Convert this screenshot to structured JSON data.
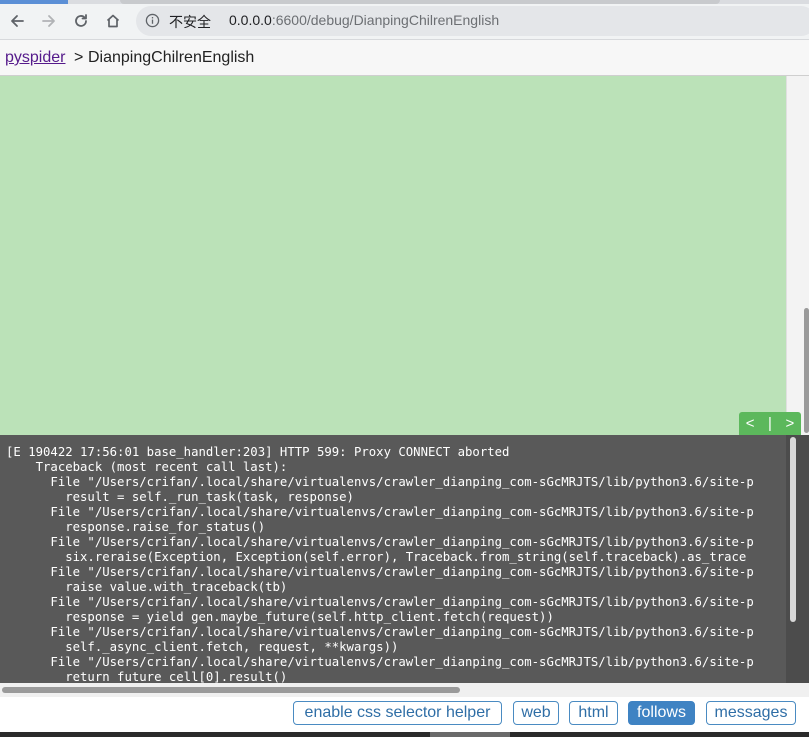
{
  "browser": {
    "security_label": "不安全",
    "url_host": "0.0.0.0",
    "url_rest": ":6600/debug/DianpingChilrenEnglish"
  },
  "breadcrumb": {
    "root": "pyspider",
    "separator": ">",
    "project": "DianpingChilrenEnglish"
  },
  "pager": {
    "prev": "<",
    "divider": "|",
    "next": ">"
  },
  "console": {
    "text": "[E 190422 17:56:01 base_handler:203] HTTP 599: Proxy CONNECT aborted\n    Traceback (most recent call last):\n      File \"/Users/crifan/.local/share/virtualenvs/crawler_dianping_com-sGcMRJTS/lib/python3.6/site-p\n        result = self._run_task(task, response)\n      File \"/Users/crifan/.local/share/virtualenvs/crawler_dianping_com-sGcMRJTS/lib/python3.6/site-p\n        response.raise_for_status()\n      File \"/Users/crifan/.local/share/virtualenvs/crawler_dianping_com-sGcMRJTS/lib/python3.6/site-p\n        six.reraise(Exception, Exception(self.error), Traceback.from_string(self.traceback).as_trace\n      File \"/Users/crifan/.local/share/virtualenvs/crawler_dianping_com-sGcMRJTS/lib/python3.6/site-p\n        raise value.with_traceback(tb)\n      File \"/Users/crifan/.local/share/virtualenvs/crawler_dianping_com-sGcMRJTS/lib/python3.6/site-p\n        response = yield gen.maybe_future(self.http_client.fetch(request))\n      File \"/Users/crifan/.local/share/virtualenvs/crawler_dianping_com-sGcMRJTS/lib/python3.6/site-p\n        self._async_client.fetch, request, **kwargs))\n      File \"/Users/crifan/.local/share/virtualenvs/crawler_dianping_com-sGcMRJTS/lib/python3.6/site-p\n        return future_cell[0].result()"
  },
  "actions": {
    "css_helper": "enable css selector helper",
    "web": "web",
    "html": "html",
    "follows": "follows",
    "messages": "messages"
  },
  "icons": [
    "back-arrow-icon",
    "forward-arrow-icon",
    "reload-icon",
    "home-icon",
    "info-icon"
  ],
  "colors": {
    "preview_bg": "#bbe2b8",
    "pager_bg": "#5cb85c",
    "console_bg": "#595959",
    "active_button": "#3f83c3"
  }
}
